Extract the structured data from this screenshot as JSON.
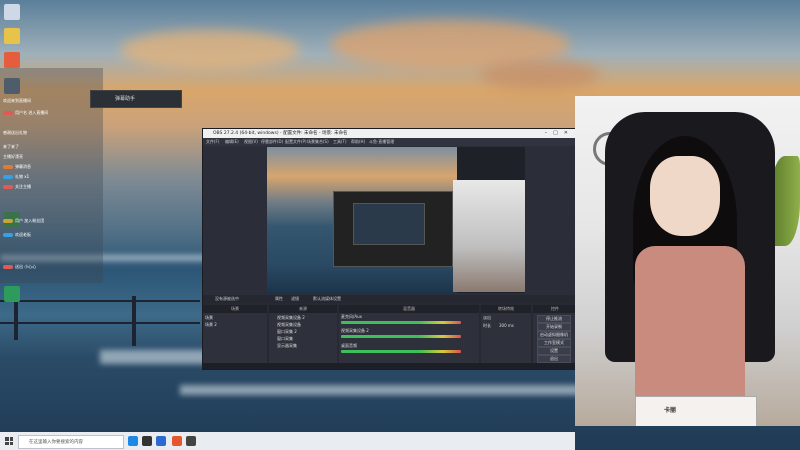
{
  "obs": {
    "title": "OBS 27.2.4 (64-bit, windows) - 配置文件: 未命名 - 场景: 未命名",
    "menu": [
      "文件(F)",
      "编辑(E)",
      "视图(V)",
      "停靠部件(D)",
      "配置文件(P)",
      "场景集合(S)",
      "工具(T)",
      "帮助(H)",
      "斗鱼·直播管理"
    ],
    "panels": {
      "scenes_header": "场景",
      "sources_header": "来源",
      "mixer_header": "混音器",
      "transitions_header": "转场特效",
      "controls_header": "控件",
      "scenes": [
        "场景",
        "场景 2"
      ],
      "sources": [
        "视频采集设备 2",
        "视频采集设备",
        "窗口采集 2",
        "窗口采集",
        "显示器采集"
      ],
      "mixer_tracks": [
        "麦克风/Aux",
        "视频采集设备 2",
        "桌面音频"
      ],
      "transition_fade": "淡出",
      "transition_duration_label": "时长",
      "transition_duration": "300 ms",
      "controls": [
        "停止推流",
        "开始录制",
        "启动虚拟摄像机",
        "工作室模式",
        "设置",
        "退出"
      ],
      "filter_label": "没有源被选中",
      "properties_label": "属性",
      "filters_label": "滤镜",
      "stream_settings": "默认流媒体设置"
    }
  },
  "chat": {
    "lines": [
      "欢迎来到直播间",
      "用户名 进入直播间",
      "感谢送出礼物",
      "来了来了",
      "主播好漂亮",
      "弹幕消息",
      "礼物 x1",
      "关注主播",
      "用户 加入粉丝团",
      "欢迎老板",
      "送出 小心心"
    ]
  },
  "mini_bar": {
    "label": "弹幕助手"
  },
  "cam": {
    "box_text": "卡丽"
  },
  "taskbar": {
    "search_placeholder": "在这里输入你要搜索的内容"
  },
  "colors": {
    "accent_green": "#3fbf5a",
    "meter_yellow": "#d6c93a",
    "meter_red": "#d9534f",
    "obs_bg": "#2b2e38"
  }
}
